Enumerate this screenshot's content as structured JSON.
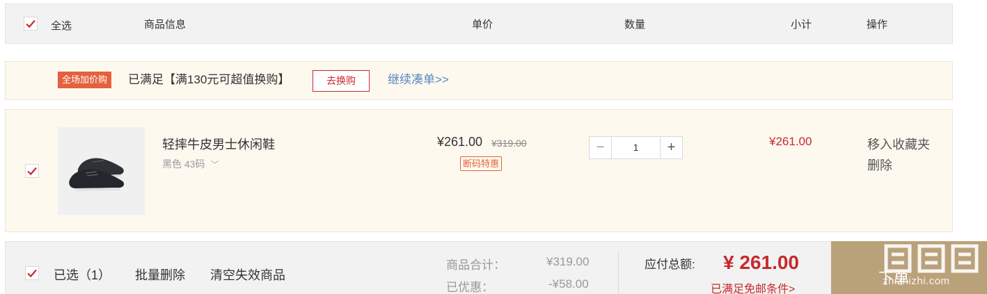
{
  "header": {
    "select_all": "全选",
    "product_info": "商品信息",
    "unit_price": "单价",
    "quantity": "数量",
    "subtotal": "小计",
    "operation": "操作"
  },
  "promo": {
    "badge": "全场加价购",
    "text": "已满足【满130元可超值换购】",
    "button": "去换购",
    "link": "继续凑单>>"
  },
  "item": {
    "checked": true,
    "name": "轻摔牛皮男士休闲鞋",
    "spec": "黑色 43码",
    "price": "¥261.00",
    "original_price": "¥319.00",
    "tag": "断码特惠",
    "quantity": "1",
    "subtotal": "¥261.00",
    "op_favorite": "移入收藏夹",
    "op_delete": "删除"
  },
  "footer": {
    "selected": "已选（1）",
    "batch_delete": "批量删除",
    "clear_invalid": "清空失效商品",
    "goods_total_label": "商品合计：",
    "goods_total_value": "¥319.00",
    "discount_label": "已优惠：",
    "discount_value": "-¥58.00",
    "payable_label": "应付总额:",
    "payable_value": "¥ 261.00",
    "free_shipping": "已满足免邮条件>",
    "submit": "下单"
  },
  "watermark": {
    "text": "zhizhizhi.com"
  },
  "colors": {
    "accent_red": "#c8282d",
    "promo_orange": "#e4613d",
    "link_blue": "#5a86c4",
    "submit_bg": "#b9a17a",
    "row_bg": "#fdf9ef",
    "header_bg": "#f2f2f2"
  },
  "icons": {
    "checkbox": "check-icon",
    "minus": "minus-icon",
    "plus": "plus-icon",
    "dropdown": "chevron-down-icon"
  }
}
